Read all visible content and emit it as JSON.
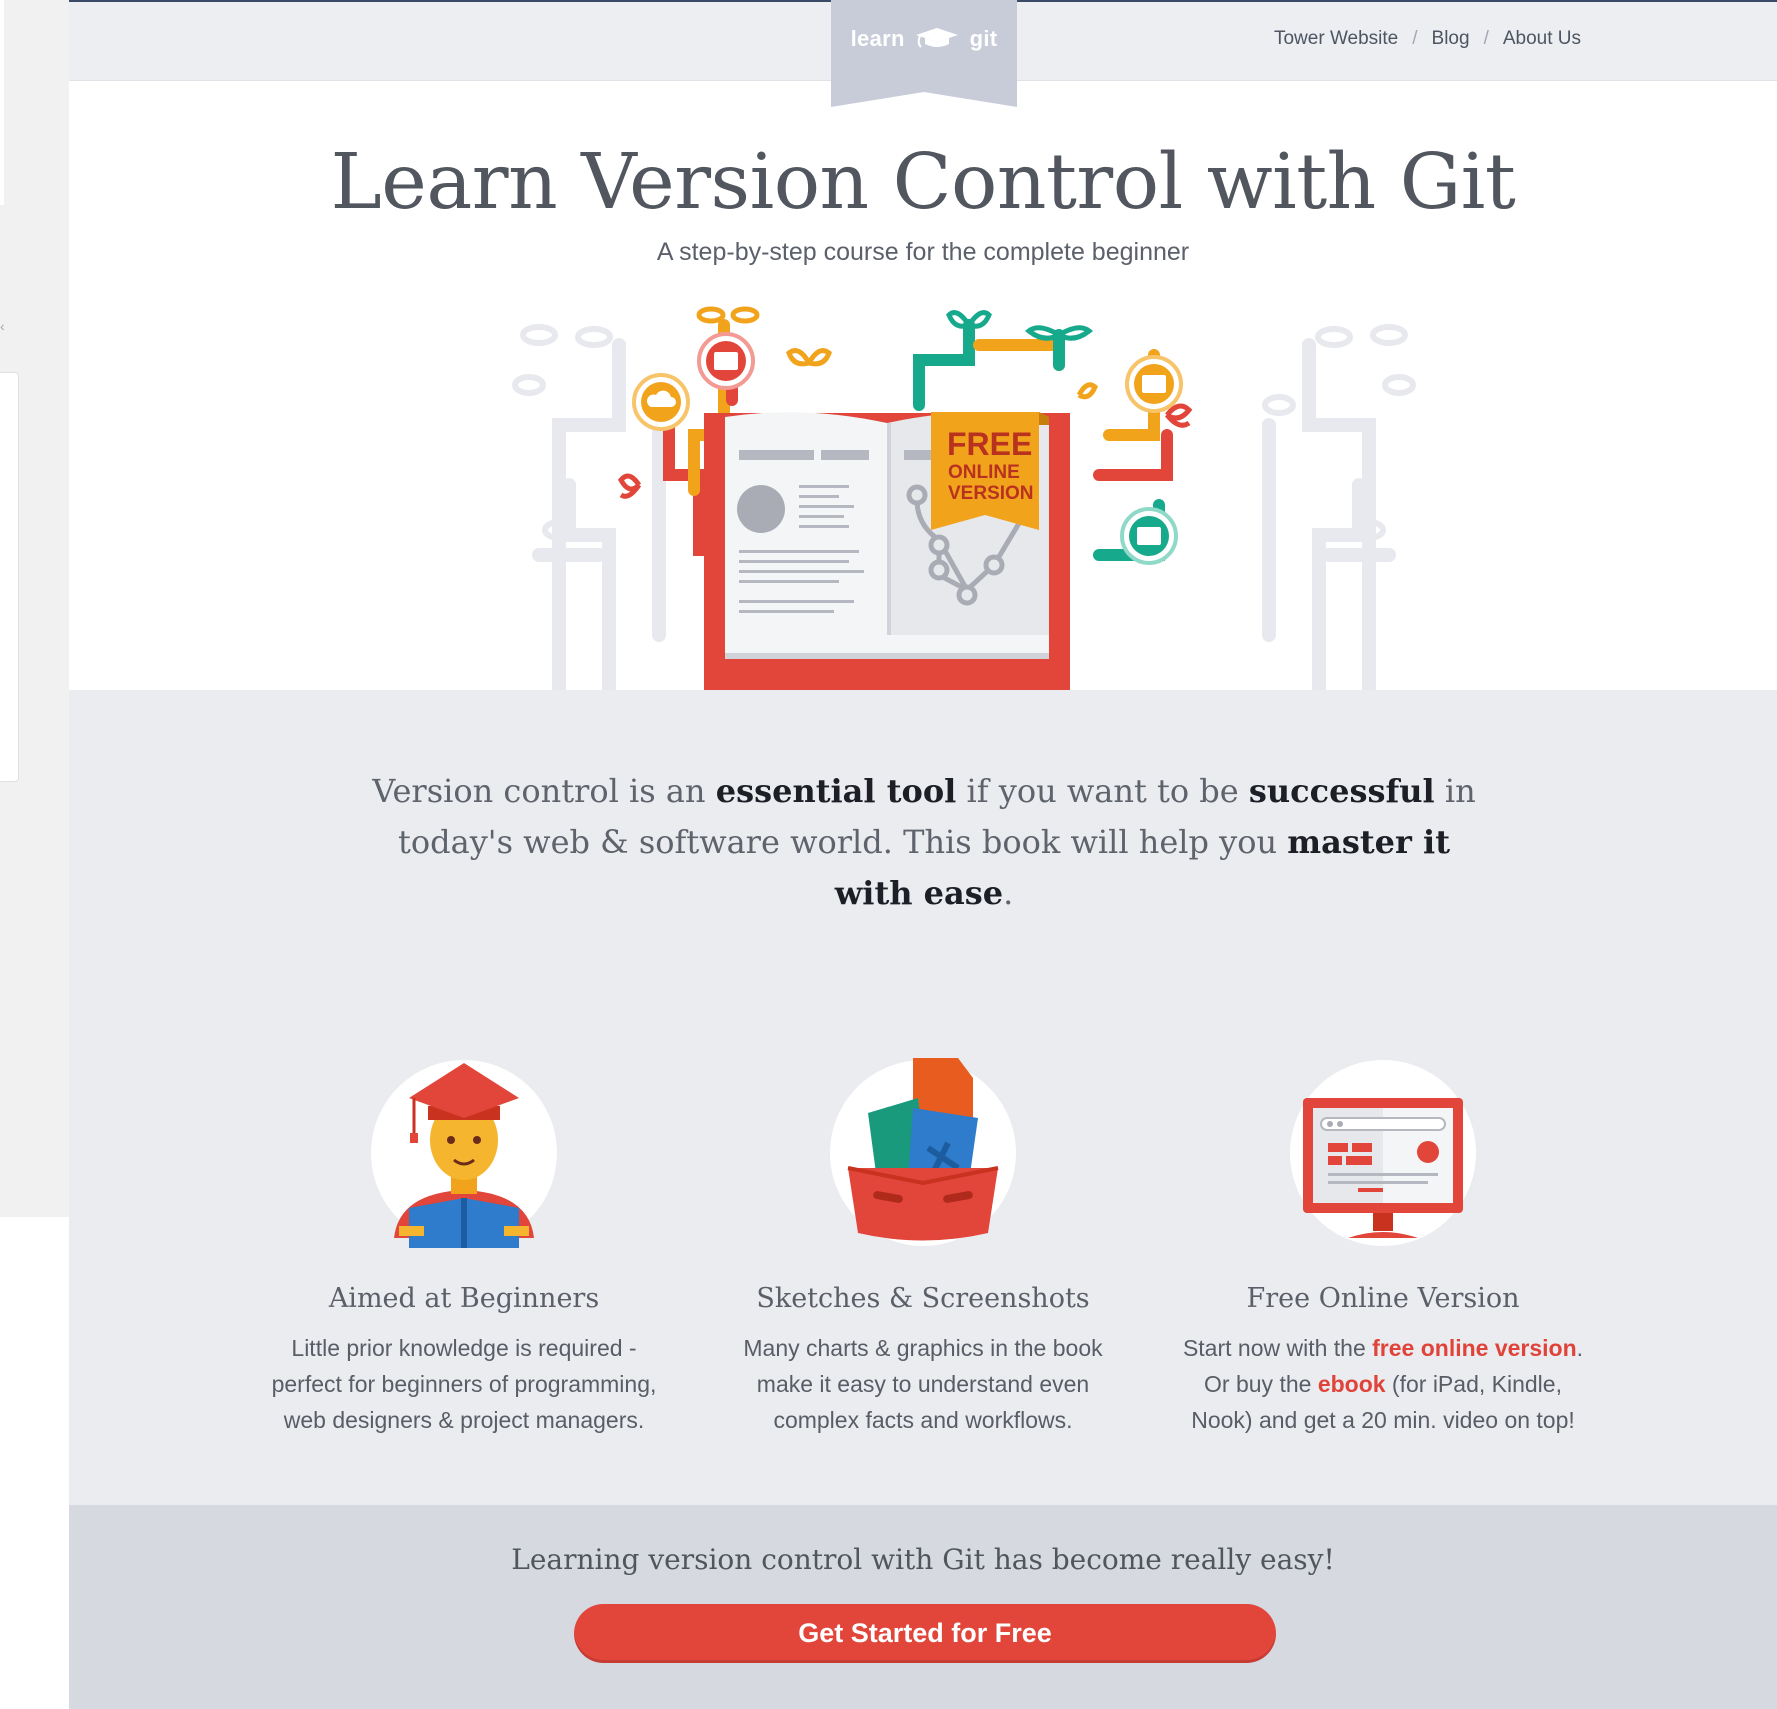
{
  "header": {
    "logo": {
      "left": "learn",
      "right": "git"
    },
    "nav": [
      {
        "label": "Tower Website"
      },
      {
        "label": "Blog"
      },
      {
        "label": "About Us"
      }
    ],
    "separator": "/"
  },
  "hero": {
    "title": "Learn Version Control with Git",
    "subtitle": "A step-by-step course for the complete beginner",
    "badge": {
      "line1": "FREE",
      "line2": "ONLINE",
      "line3": "VERSION"
    }
  },
  "intro": {
    "segments": [
      {
        "text": "Version control is an ",
        "strong": false
      },
      {
        "text": "essential tool",
        "strong": true
      },
      {
        "text": " if you want to be ",
        "strong": false
      },
      {
        "text": "successful",
        "strong": true
      },
      {
        "text": " in today's web & software world. This book will help you ",
        "strong": false
      },
      {
        "text": "master it with ease",
        "strong": true
      },
      {
        "text": ".",
        "strong": false
      }
    ]
  },
  "features": [
    {
      "title": "Aimed at Beginners",
      "line1": "Little prior knowledge is required -",
      "line2": "perfect for beginners of programming,",
      "line3": "web designers & project managers."
    },
    {
      "title": "Sketches & Screenshots",
      "line1": "Many charts & graphics in the book",
      "line2": "make it easy to understand even",
      "line3": "complex facts and workflows."
    },
    {
      "title": "Free Online Version",
      "pre": "Start now with the ",
      "link1": "free online version",
      "mid1": ".",
      "pre2": "Or buy the ",
      "link2": "ebook",
      "mid2": " (for iPad, Kindle,",
      "line3": "Nook) and get a 20 min. video on top!"
    }
  ],
  "cta": {
    "text": "Learning version control with Git has become really easy!",
    "button": "Get Started for Free"
  },
  "colors": {
    "accent_red": "#e2453a",
    "header_bg": "#eceef2",
    "band_bg": "#ebecf0",
    "cta_bg": "#d6d9e0"
  }
}
